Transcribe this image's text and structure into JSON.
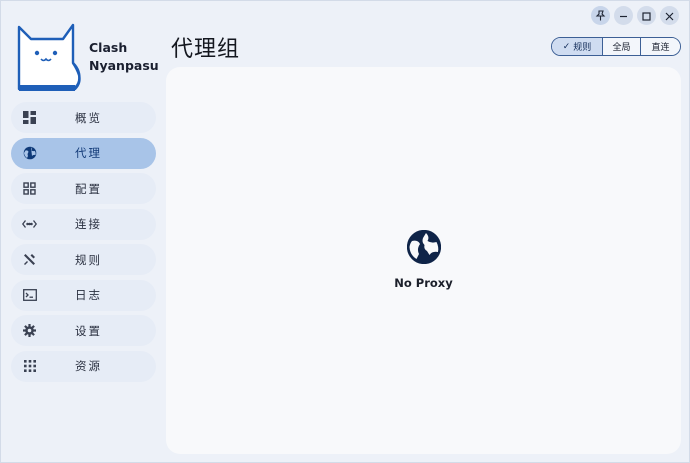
{
  "app": {
    "name_line1": "Clash",
    "name_line2": "Nyanpasu"
  },
  "window_controls": [
    {
      "icon": "pin-icon"
    },
    {
      "icon": "minimize-icon"
    },
    {
      "icon": "maximize-icon"
    },
    {
      "icon": "close-icon"
    }
  ],
  "sidebar": {
    "items": [
      {
        "label": "概览",
        "icon": "dashboard-icon",
        "active": false
      },
      {
        "label": "代理",
        "icon": "globe-icon",
        "active": true
      },
      {
        "label": "配置",
        "icon": "grid-icon",
        "active": false
      },
      {
        "label": "连接",
        "icon": "code-arrows-icon",
        "active": false
      },
      {
        "label": "规则",
        "icon": "tools-icon",
        "active": false
      },
      {
        "label": "日志",
        "icon": "terminal-icon",
        "active": false
      },
      {
        "label": "设置",
        "icon": "gear-icon",
        "active": false
      },
      {
        "label": "资源",
        "icon": "apps-icon",
        "active": false
      }
    ]
  },
  "header": {
    "title": "代理组",
    "modes": [
      {
        "label": "规则",
        "active": true
      },
      {
        "label": "全局",
        "active": false
      },
      {
        "label": "直连",
        "active": false
      }
    ]
  },
  "main": {
    "empty_text": "No Proxy",
    "empty_icon": "globe-icon"
  },
  "colors": {
    "accent": "#a8c4e8",
    "accent_dark": "#3c5f95",
    "background": "#edf1f8",
    "panel": "#f8f9fb"
  }
}
